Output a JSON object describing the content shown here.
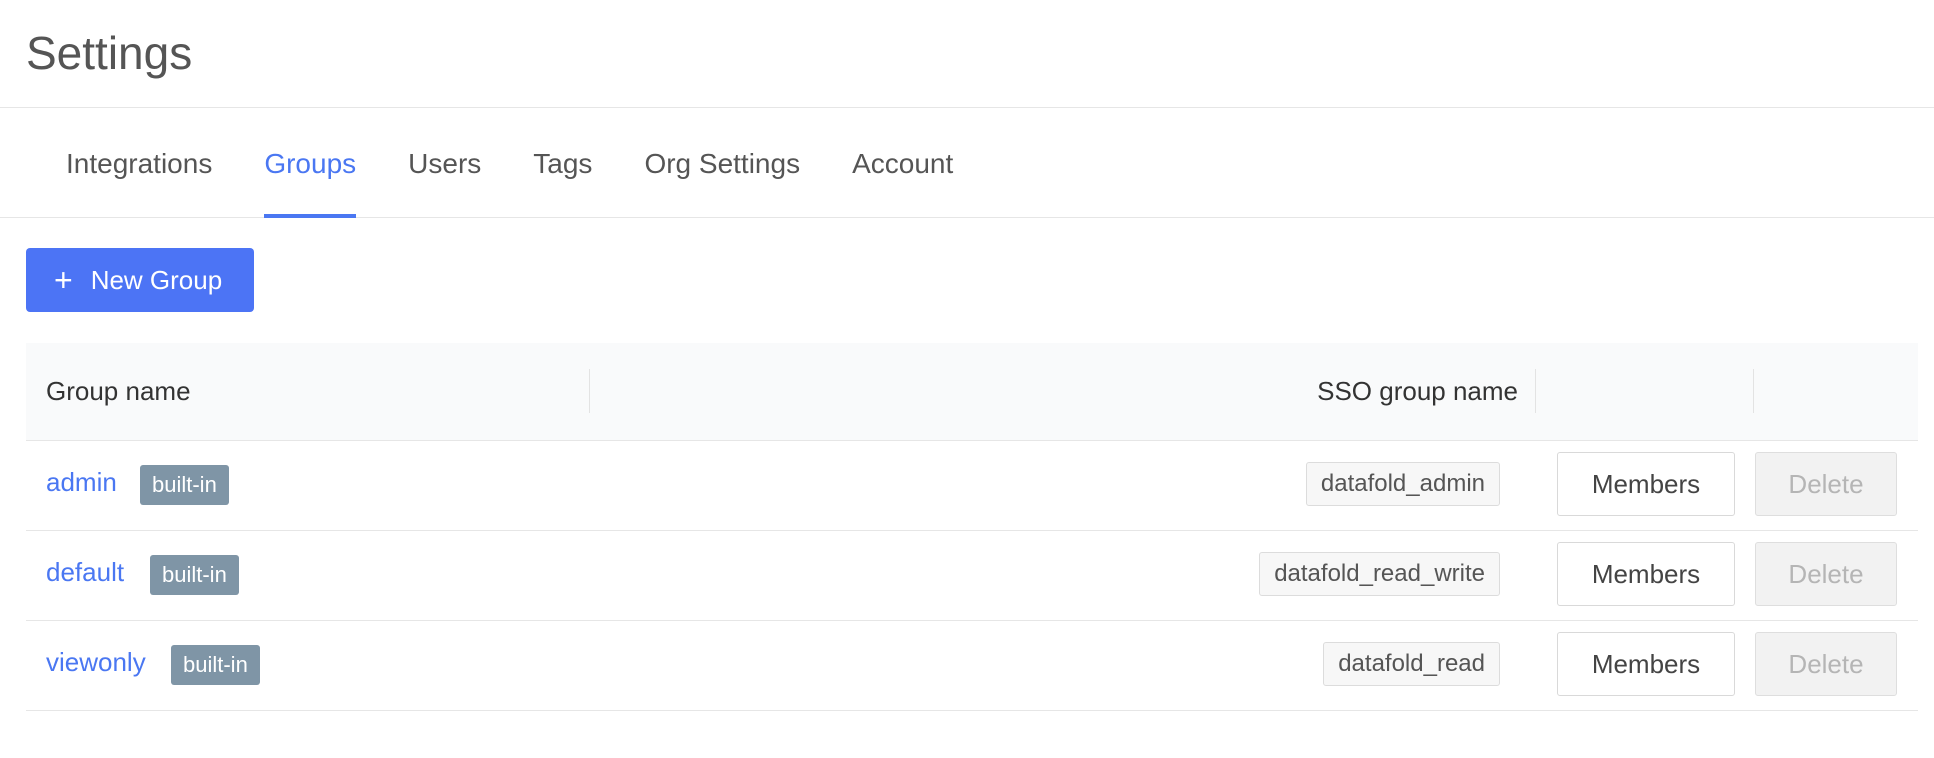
{
  "page": {
    "title": "Settings"
  },
  "tabs": [
    {
      "label": "Integrations",
      "active": false
    },
    {
      "label": "Groups",
      "active": true
    },
    {
      "label": "Users",
      "active": false
    },
    {
      "label": "Tags",
      "active": false
    },
    {
      "label": "Org Settings",
      "active": false
    },
    {
      "label": "Account",
      "active": false
    }
  ],
  "toolbar": {
    "new_group_label": "New Group",
    "new_group_icon": "plus-icon"
  },
  "table": {
    "headers": {
      "group_name": "Group name",
      "sso_group_name": "SSO group name"
    },
    "rows": [
      {
        "name": "admin",
        "badge": "built-in",
        "sso": "datafold_admin",
        "members_label": "Members",
        "delete_label": "Delete"
      },
      {
        "name": "default",
        "badge": "built-in",
        "sso": "datafold_read_write",
        "members_label": "Members",
        "delete_label": "Delete"
      },
      {
        "name": "viewonly",
        "badge": "built-in",
        "sso": "datafold_read",
        "members_label": "Members",
        "delete_label": "Delete"
      }
    ]
  },
  "colors": {
    "accent": "#4a77f2",
    "button": "#4c74f5",
    "badge": "#7f95a6"
  }
}
